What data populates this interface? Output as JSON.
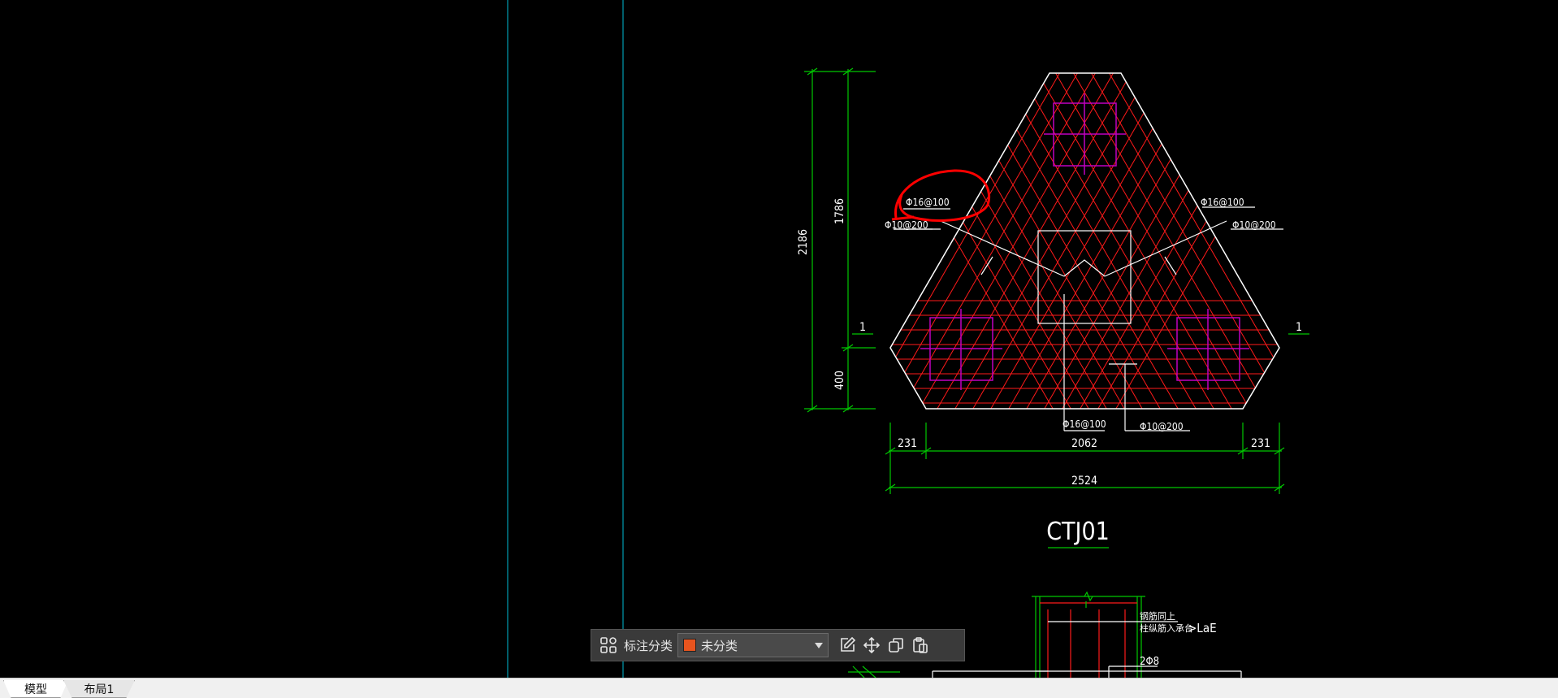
{
  "drawing": {
    "dimensions": {
      "height_total": "2186",
      "height_upper": "1786",
      "height_lower": "400",
      "bottom_left": "231",
      "bottom_middle": "2062",
      "bottom_right": "231",
      "bottom_total": "2524"
    },
    "rebar_labels": {
      "top_left_circled": "Φ16@100",
      "left_secondary": "Φ10@200",
      "top_right": "Φ16@100",
      "right_secondary": "Φ10@200",
      "bottom_main": "Φ16@100",
      "bottom_secondary": "Φ10@200"
    },
    "section_marks": {
      "left": "1",
      "right": "1"
    },
    "title": "CTJ01",
    "detail": {
      "note_line1": "钢筋同上",
      "note_line2": "柱纵筋入承台",
      "lae_text": ">LaE",
      "stirrup": "2Φ8"
    }
  },
  "annotation_toolbar": {
    "label": "标注分类",
    "category_value": "未分类",
    "category_color": "#e8541e",
    "icons": [
      "grid-icon",
      "edit-icon",
      "move-icon",
      "copy-icon",
      "paste-icon"
    ]
  },
  "tabs": [
    {
      "label": "模型",
      "active": true
    },
    {
      "label": "布局1",
      "active": false
    }
  ],
  "colors": {
    "background": "#000000",
    "outline": "#ffffff",
    "rebar": "#ff1a1a",
    "dimension": "#00c800",
    "pile": "#c000c0",
    "guide_line": "#00bcd4",
    "markup_circle": "#ff0000"
  }
}
